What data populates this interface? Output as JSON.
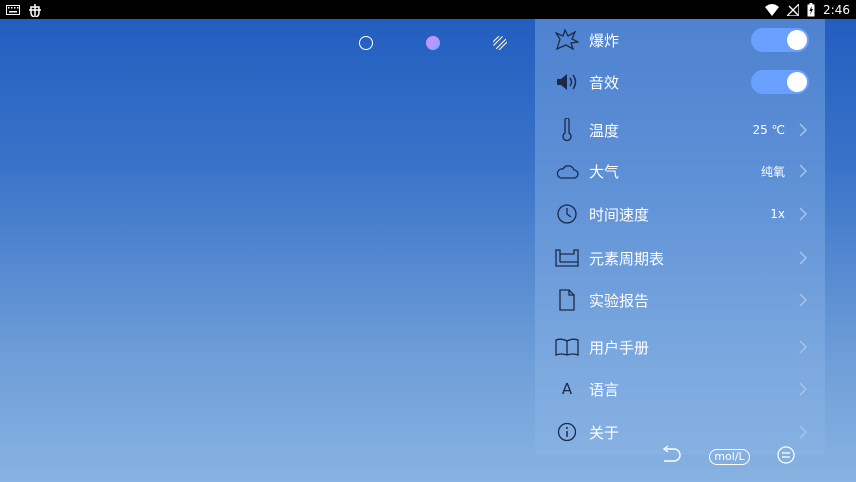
{
  "status_bar": {
    "time": "2:46",
    "left_icons": [
      "keyboard-icon",
      "bug-icon"
    ],
    "right_icons": [
      "wifi-icon",
      "no-signal-icon",
      "battery-icon"
    ]
  },
  "top_icons": [
    "empty-circle-icon",
    "gradient-circle-icon",
    "hatched-circle-icon"
  ],
  "settings": {
    "explosion": {
      "label": "爆炸",
      "icon": "explosion-icon",
      "enabled": true
    },
    "sound": {
      "label": "音效",
      "icon": "speaker-icon",
      "enabled": true
    },
    "temperature": {
      "label": "温度",
      "icon": "thermometer-icon",
      "value": "25 ℃"
    },
    "atmosphere": {
      "label": "大气",
      "icon": "cloud-icon",
      "value": "纯氧"
    },
    "time_speed": {
      "label": "时间速度",
      "icon": "clock-icon",
      "value": "1x"
    },
    "periodic_table": {
      "label": "元素周期表",
      "icon": "periodic-table-icon"
    },
    "report": {
      "label": "实验报告",
      "icon": "document-icon"
    },
    "manual": {
      "label": "用户手册",
      "icon": "book-icon"
    },
    "language": {
      "label": "语言",
      "icon": "letter-a-icon",
      "glyph": "A"
    },
    "about": {
      "label": "关于",
      "icon": "info-icon"
    }
  },
  "bottom_bar": {
    "unit_label": "mol/L",
    "icons": [
      "undo-icon",
      "unit-icon",
      "menu-circle-icon"
    ]
  },
  "colors": {
    "bg_top": "#1f5bbe",
    "bg_bottom": "#88b3e2",
    "toggle_on": "#6aa0ff"
  }
}
